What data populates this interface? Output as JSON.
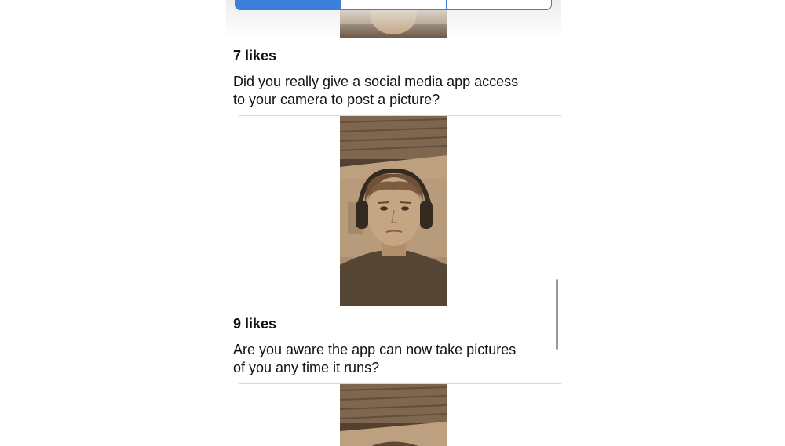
{
  "segmented_control": {
    "segments": [
      "",
      "",
      ""
    ],
    "active_index": 0
  },
  "feed": {
    "posts": [
      {
        "likes": "7 likes",
        "caption_lines": [
          "Did you really give a social media app access",
          "to your camera to post a picture?"
        ]
      },
      {
        "likes": "9 likes",
        "caption_lines": [
          "Are you aware the app can now take pictures",
          "of you any time it runs?"
        ]
      }
    ]
  },
  "colors": {
    "accent": "#3b7fd9",
    "photo_tint": "#8a7058",
    "separator": "#d6d6d6"
  }
}
